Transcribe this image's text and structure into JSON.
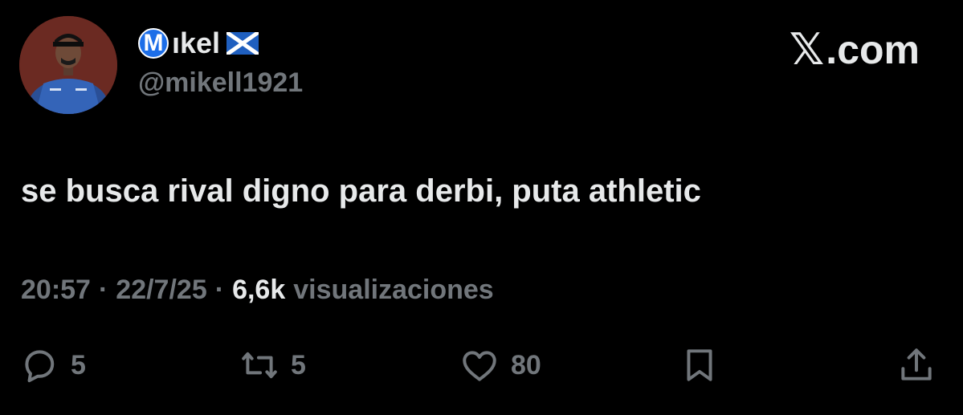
{
  "author": {
    "display_name": "Mɪkel",
    "badge_letter": "M",
    "name_rest": "ıkel",
    "handle": "@mikell1921",
    "flag_icon": "scotland-flag-icon"
  },
  "brand": {
    "logo_glyph": "𝕏",
    "text": ".com"
  },
  "tweet": {
    "text": "se busca rival digno para derbi, puta athletic",
    "time": "20:57",
    "date": "22/7/25",
    "views_count": "6,6k",
    "views_label": "visualizaciones",
    "separator": "·"
  },
  "actions": {
    "replies": "5",
    "retweets": "5",
    "likes": "80"
  },
  "colors": {
    "background": "#000000",
    "text_primary": "#e7e9ea",
    "text_secondary": "#71767b",
    "badge_blue": "#1d6ee8",
    "flag_blue": "#1f5fbf"
  }
}
